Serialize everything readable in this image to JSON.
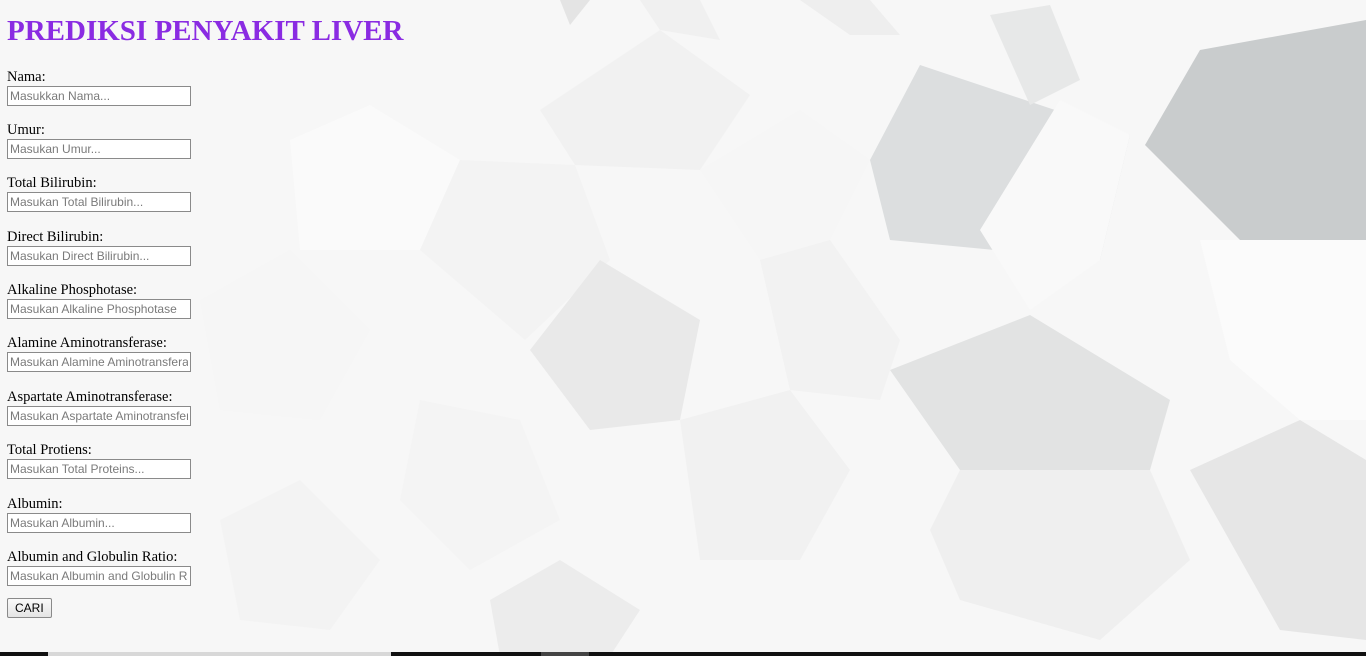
{
  "page": {
    "title": "PREDIKSI PENYAKIT LIVER",
    "title_color": "#8a2be2"
  },
  "form": {
    "fields": [
      {
        "label": "Nama:",
        "placeholder": "Masukkan Nama..."
      },
      {
        "label": "Umur:",
        "placeholder": "Masukan Umur..."
      },
      {
        "label": "Total Bilirubin:",
        "placeholder": "Masukan Total Bilirubin..."
      },
      {
        "label": "Direct Bilirubin:",
        "placeholder": "Masukan Direct Bilirubin..."
      },
      {
        "label": "Alkaline Phosphotase:",
        "placeholder": "Masukan Alkaline Phosphotase"
      },
      {
        "label": "Alamine Aminotransferase:",
        "placeholder": "Masukan Alamine Aminotransferase"
      },
      {
        "label": "Aspartate Aminotransferase:",
        "placeholder": "Masukan Aspartate Aminotransferase"
      },
      {
        "label": "Total Protiens:",
        "placeholder": "Masukan Total Proteins..."
      },
      {
        "label": "Albumin:",
        "placeholder": "Masukan Albumin..."
      },
      {
        "label": "Albumin and Globulin Ratio:",
        "placeholder": "Masukan Albumin and Globulin Ratio"
      }
    ],
    "submit_label": "CARI"
  }
}
